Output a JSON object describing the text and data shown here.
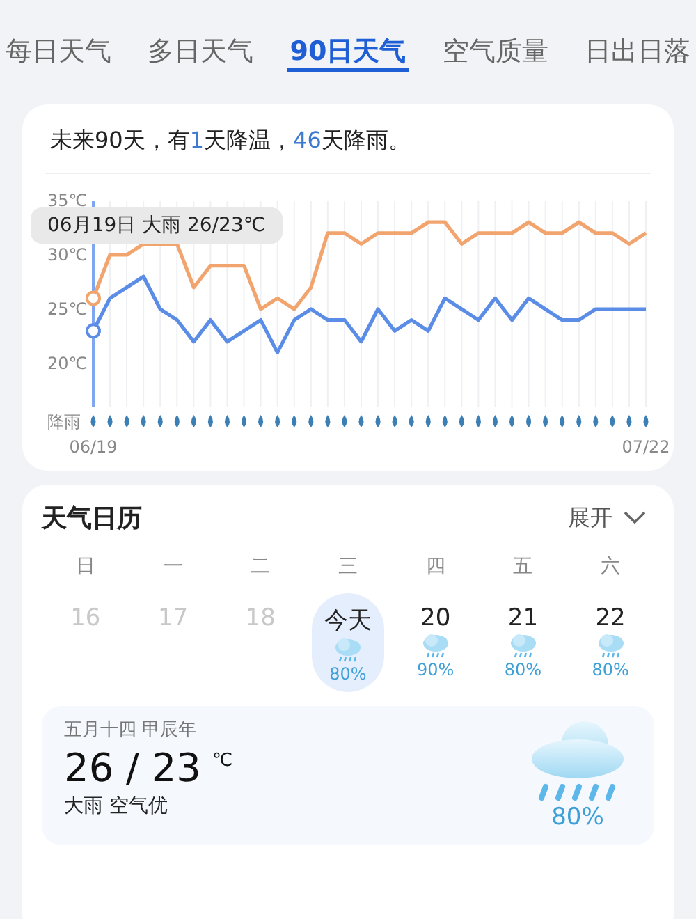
{
  "tabs": [
    {
      "label": "每日天气",
      "selected": false
    },
    {
      "label": "多日天气",
      "selected": false
    },
    {
      "label": "90日天气",
      "selected": true
    },
    {
      "label": "空气质量",
      "selected": false
    },
    {
      "label": "日出日落",
      "selected": false
    }
  ],
  "forecast": {
    "summary_parts": [
      {
        "text": "未来90天，有",
        "highlight": false
      },
      {
        "text": "1",
        "highlight": true
      },
      {
        "text": "天降温，",
        "highlight": false
      },
      {
        "text": "46",
        "highlight": true
      },
      {
        "text": "天降雨。",
        "highlight": false
      }
    ],
    "tooltip": "06月19日 大雨 26/23℃",
    "rain_label": "降雨",
    "chart_data": {
      "type": "line",
      "categories": [
        "06/19",
        null,
        null,
        null,
        null,
        null,
        null,
        null,
        null,
        null,
        null,
        null,
        null,
        null,
        null,
        null,
        null,
        null,
        null,
        null,
        null,
        null,
        null,
        null,
        null,
        null,
        null,
        null,
        null,
        null,
        null,
        null,
        null,
        "07/22"
      ],
      "yticks": [
        {
          "value": 20,
          "label": "20℃"
        },
        {
          "value": 25,
          "label": "25℃"
        },
        {
          "value": 30,
          "label": "30℃"
        },
        {
          "value": 35,
          "label": "35℃"
        }
      ],
      "ylim": [
        16,
        35
      ],
      "grid": true,
      "series": [
        {
          "color": "#f2a46e",
          "values": [
            26,
            30,
            30,
            31,
            31,
            31,
            27,
            29,
            29,
            29,
            25,
            26,
            25,
            27,
            32,
            32,
            31,
            32,
            32,
            32,
            33,
            33,
            31,
            32,
            32,
            32,
            33,
            32,
            32,
            33,
            32,
            32,
            31,
            32
          ]
        },
        {
          "color": "#5b8de6",
          "values": [
            23,
            26,
            27,
            28,
            25,
            24,
            22,
            24,
            22,
            23,
            24,
            21,
            24,
            25,
            24,
            24,
            22,
            25,
            23,
            24,
            23,
            26,
            25,
            24,
            26,
            24,
            26,
            25,
            24,
            24,
            25,
            25,
            25,
            25
          ]
        }
      ]
    }
  },
  "calendar": {
    "title": "天气日历",
    "expand": "展开",
    "weekdays": [
      "日",
      "一",
      "二",
      "三",
      "四",
      "五",
      "六"
    ],
    "days": [
      {
        "label": "16",
        "past": true,
        "selected": false
      },
      {
        "label": "17",
        "past": true,
        "selected": false
      },
      {
        "label": "18",
        "past": true,
        "selected": false
      },
      {
        "label": "今天",
        "past": false,
        "selected": true,
        "rain": "80%"
      },
      {
        "label": "20",
        "past": false,
        "selected": false,
        "rain": "90%"
      },
      {
        "label": "21",
        "past": false,
        "selected": false,
        "rain": "80%"
      },
      {
        "label": "22",
        "past": false,
        "selected": false,
        "rain": "80%"
      }
    ],
    "detail": {
      "lunar": "五月十四 甲辰年",
      "temps": "26 / 23",
      "unit": "℃",
      "condition": "大雨 空气优",
      "rain": "80%"
    }
  }
}
